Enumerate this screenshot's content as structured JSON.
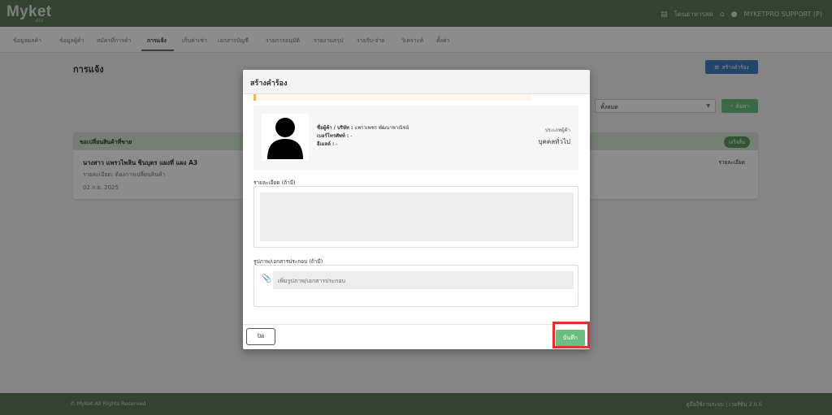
{
  "app": {
    "logo": "Myket",
    "logo_sub": "ccc",
    "top_right": {
      "store_label": "โดนอาหารสด",
      "user_label": "MYKETPRO SUPPORT (P)"
    }
  },
  "nav": {
    "tabs": [
      {
        "label": "ข้อมูลผลค้า"
      },
      {
        "label": "ข้อมูลผู้ค้า"
      },
      {
        "label": "สมัครที่การค้า"
      },
      {
        "label": "การแจ้ง"
      },
      {
        "label": "เก็บค่าเช่า"
      },
      {
        "label": "เอกสารบัญชี"
      },
      {
        "label": "รายการอนุมัติ"
      },
      {
        "label": "รายงานสรุป"
      },
      {
        "label": "รายรับ-จ่าย"
      },
      {
        "label": "วิเคราะห์"
      },
      {
        "label": "ตั้งค่า"
      }
    ]
  },
  "page": {
    "title": "การแจ้ง",
    "create_button": "สร้างคำร้อง",
    "filter_value": "ทั้งหมด",
    "search_button": "ค้นหา",
    "card": {
      "header": "ขอเปลี่ยนสินค้าที่ขาย",
      "badge": "เสร็จสิ้น",
      "name": "นางสาว แพรวไพลิน ชินบุตร แผงที่ แผง A3",
      "detail": "รายละเอียด: ต้องการเปลี่ยนสินค้า",
      "date": "02 ก.ย. 2025",
      "link": "รายละเอียด"
    }
  },
  "footer": {
    "left": "© MyKet All Rights Reserved",
    "right": "คู่มือใช้งานระบบ | เวอร์ชั่น 2.0.6"
  },
  "modal": {
    "title": "สร้างคำร้อง",
    "customer": {
      "name_label": "ชื่อผู้ค้า / บริษัท :",
      "name_value": "แพรวเพชร พัฒนาพาณิชย์",
      "phone_label": "เบอร์โทรศัพท์ :",
      "phone_value": "-",
      "email_label": "อีเมลล์ :",
      "email_value": "-",
      "type_label": "ประเภทผู้ค้า",
      "type_value": "บุคคลทั่วไป"
    },
    "details_label": "รายละเอียด (ถ้ามี)",
    "attachments_label": "รูปภาพ/เอกสารประกอบ (ถ้ามี)",
    "attach_placeholder": "เพิ่มรูปภาพ/เอกสารประกอบ",
    "close_button": "ปิด",
    "save_button": "บันทึก"
  }
}
